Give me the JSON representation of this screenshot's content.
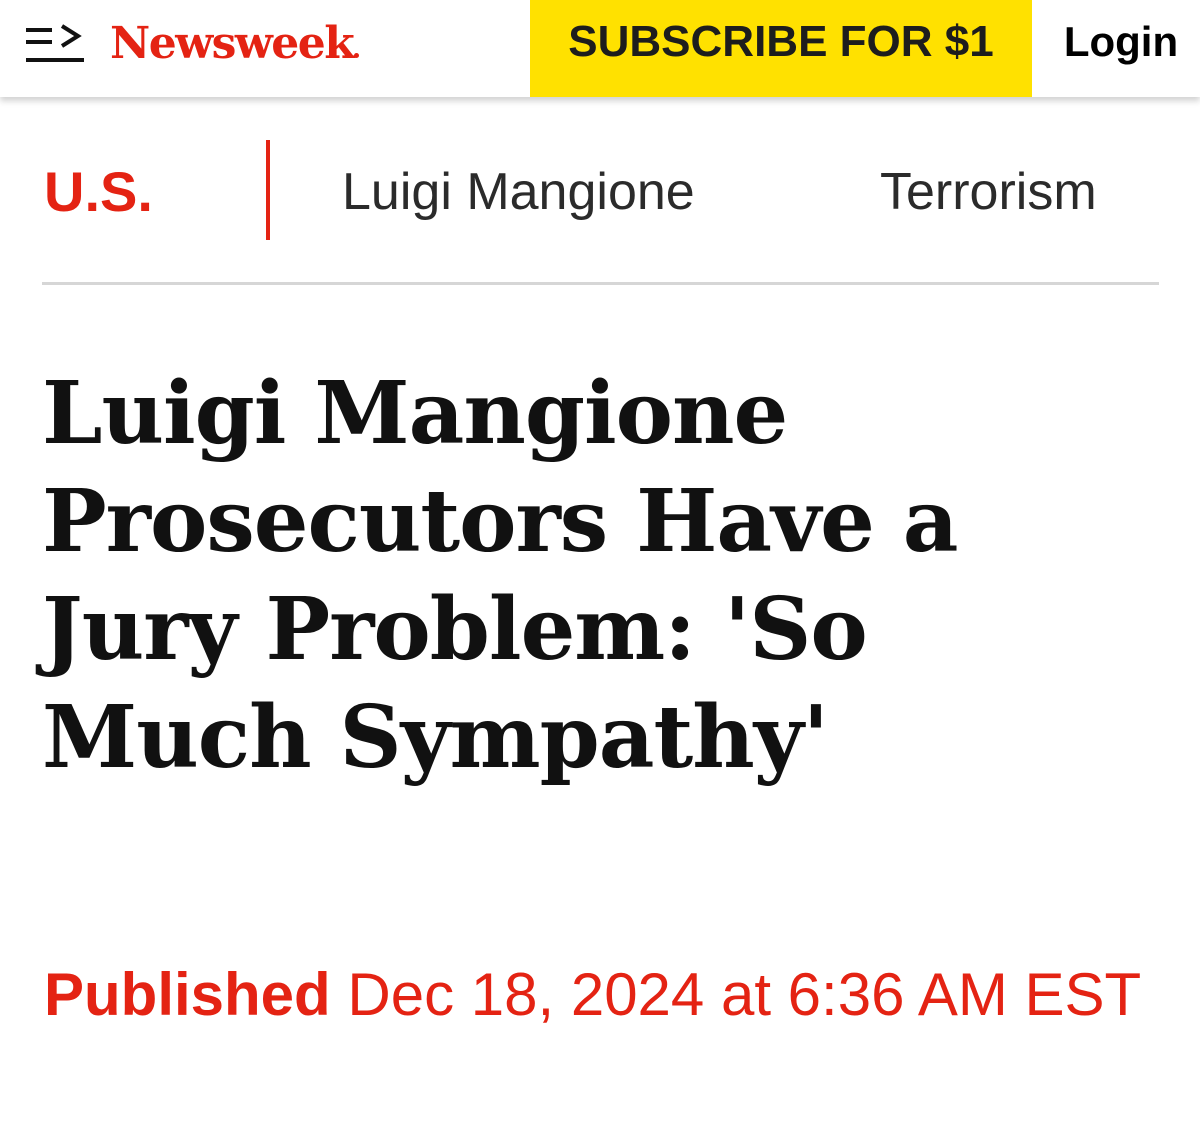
{
  "header": {
    "logo_text": "Newsweek",
    "menu_icon": "menu-arrow-icon",
    "subscribe_label": "SUBSCRIBE FOR $1",
    "login_label": "Login"
  },
  "categories": {
    "primary": "U.S.",
    "tags": [
      "Luigi Mangione",
      "Terrorism"
    ]
  },
  "article": {
    "headline": "Luigi Mangione Prosecutors Have a Jury Problem: 'So Much Sympathy'",
    "published_label": "Published",
    "published_datetime": "Dec 18, 2024 at 6:36 AM EST"
  },
  "colors": {
    "brand_red": "#e42313",
    "subscribe_yellow": "#ffe100",
    "headline_text": "#111111"
  }
}
